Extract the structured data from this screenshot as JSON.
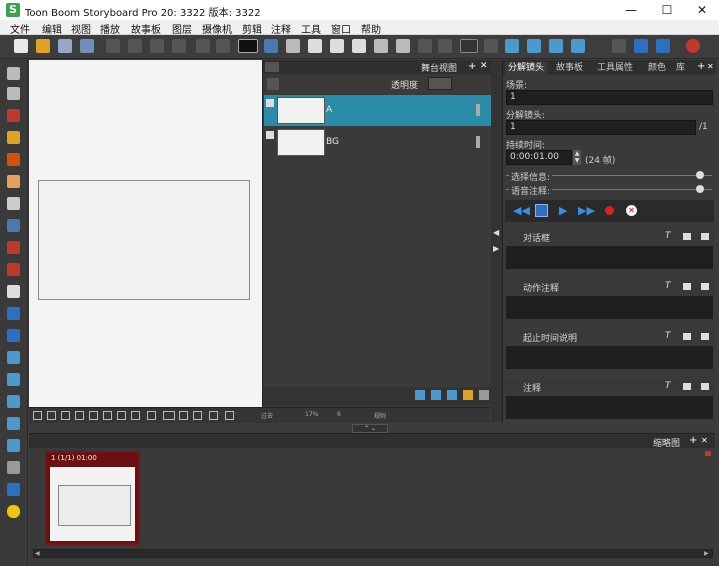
{
  "app": {
    "title": "Toon Boom Storyboard Pro 20:  3322 版本: 3322",
    "logo": "S"
  },
  "window_controls": {
    "minimize": "—",
    "maximize": "☐",
    "close": "✕"
  },
  "menu": [
    "文件",
    "编辑",
    "视图",
    "播放",
    "故事板",
    "图层",
    "摄像机",
    "剪辑",
    "注释",
    "工具",
    "窗口",
    "帮助"
  ],
  "stage_view": {
    "tab_title": "舞台视图",
    "opacity_label": "透明度",
    "layers": [
      {
        "name": "A",
        "selected": true
      },
      {
        "name": "BG",
        "selected": false
      }
    ]
  },
  "stage_toolbar": {
    "zoom_a": "过去",
    "zoom_b": "17%",
    "zoom_c": "6",
    "mode": "规则"
  },
  "properties": {
    "tabs": [
      "分解镜头",
      "故事板",
      "工具属性",
      "颜色",
      "库"
    ],
    "scene_label": "场景:",
    "scene_value": "1",
    "panel_label": "分解镜头:",
    "panel_value": "1",
    "panel_count": "/1",
    "duration_label": "持续时间:",
    "duration_value": "0:00:01.00",
    "frames_value": "(24 帧)",
    "selection_info_label": "选择信息:",
    "voice_note_label": "语音注释:",
    "sections": [
      {
        "title": "对话框"
      },
      {
        "title": "动作注释"
      },
      {
        "title": "起止时间说明"
      },
      {
        "title": "注释"
      }
    ]
  },
  "thumbnails": {
    "tab_title": "缩略图",
    "panels": [
      {
        "label": "1 (1/1) 01:00"
      }
    ]
  },
  "colors": {
    "accent_selected_layer": "#2a8ca8",
    "panel_bg": "#3a3a3a",
    "field_bg": "#1f1f1f",
    "thumbnail_border": "#7a1414"
  }
}
